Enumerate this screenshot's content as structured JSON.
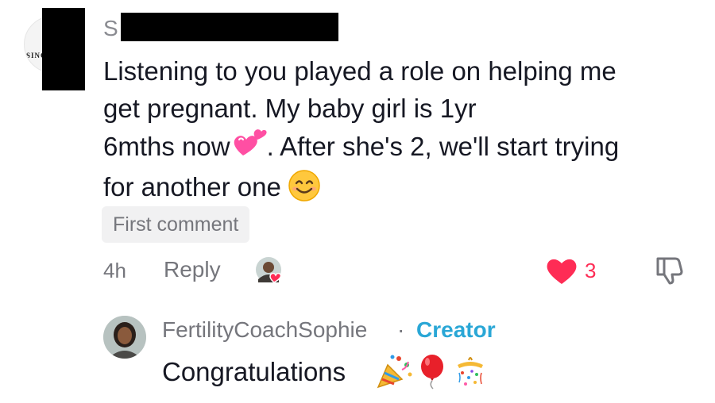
{
  "comment": {
    "username_visible": "S",
    "avatar_logo_text": "SINCE",
    "text_line1": "Listening to you played a role on helping me",
    "text_line2": "get pregnant. My baby girl is 1yr",
    "text_line3a": "6mths now",
    "text_line3b": ". After she's 2, we'll start trying",
    "text_line4": "for another one",
    "emoji_after_now": "two-hearts-emoji",
    "emoji_end": "smiling-face-emoji",
    "badge": "First comment",
    "time": "4h",
    "reply_label": "Reply",
    "like_count": "3",
    "accent_color": "#fe2c55"
  },
  "reply": {
    "author": "FertilityCoachSophie",
    "separator": "·",
    "role": "Creator",
    "text": "Congratulations",
    "emojis": [
      "party-popper-emoji",
      "balloon-emoji",
      "confetti-ball-emoji"
    ],
    "role_color": "#2aa7d6"
  }
}
